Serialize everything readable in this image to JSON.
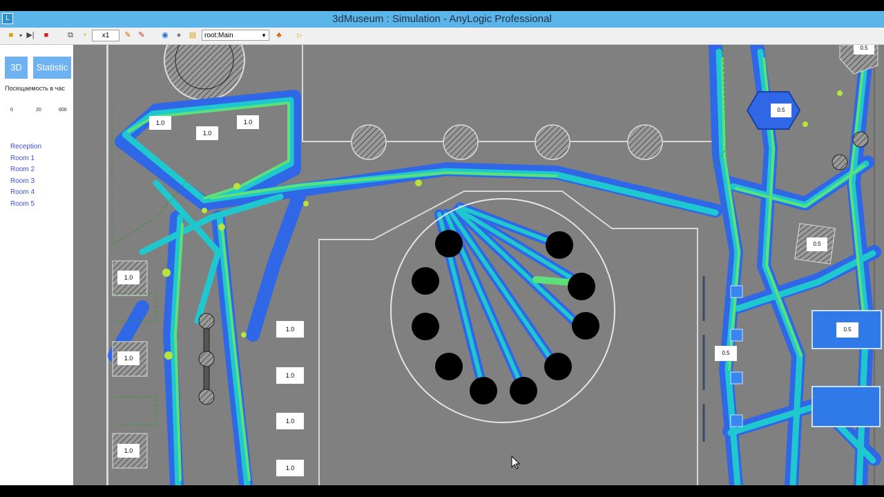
{
  "window": {
    "title": "3dMuseum : Simulation - AnyLogic Professional"
  },
  "toolbar": {
    "speed": "x1",
    "root_selector": "root:Main"
  },
  "panel": {
    "btn_3d": "3D",
    "btn_statistic": "Statistic",
    "chart_title": "Посещаемость в час",
    "axis_ticks": [
      "0",
      "20",
      "600"
    ],
    "rooms": [
      "Reception",
      "Room 1",
      "Room 2",
      "Room 3",
      "Room 4",
      "Room 5"
    ]
  },
  "map": {
    "labels": {
      "l1": "1.0",
      "l2": "1.0",
      "l3": "1.0",
      "l4": "1.0",
      "l5": "1.0",
      "l6": "1.0",
      "l7": "1.0",
      "l8": "1.0",
      "l9": "1.0",
      "l10": "1.0",
      "r1": "0.5",
      "r2": "0.5",
      "r3": "0.5",
      "r4": "0.5",
      "r5": "0.5"
    },
    "colors": {
      "floor": "#808080",
      "wall": "#d8d8d8",
      "density_low": "#2f67e6",
      "density_mid": "#1fc7cf",
      "density_high": "#5ce07a",
      "density_peak": "#b8e23c"
    }
  }
}
